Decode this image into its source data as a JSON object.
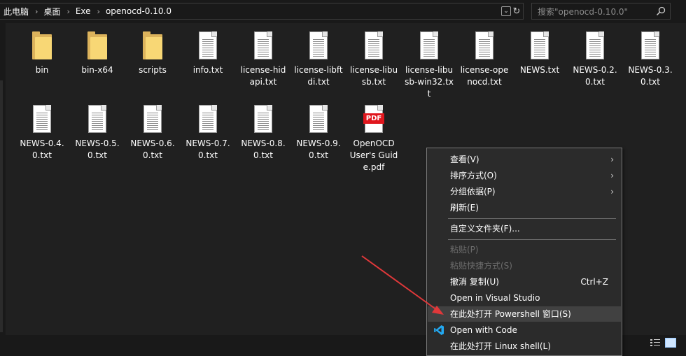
{
  "address": {
    "crumbs": [
      "此电脑",
      "桌面",
      "Exe",
      "openocd-0.10.0"
    ]
  },
  "search": {
    "placeholder": "搜索\"openocd-0.10.0\""
  },
  "files": [
    {
      "label": "bin",
      "kind": "folder"
    },
    {
      "label": "bin-x64",
      "kind": "folder"
    },
    {
      "label": "scripts",
      "kind": "folder"
    },
    {
      "label": "info.txt",
      "kind": "text"
    },
    {
      "label": "license-hidapi.txt",
      "kind": "text"
    },
    {
      "label": "license-libftdi.txt",
      "kind": "text"
    },
    {
      "label": "license-libusb.txt",
      "kind": "text"
    },
    {
      "label": "license-libusb-win32.txt",
      "kind": "text"
    },
    {
      "label": "license-openocd.txt",
      "kind": "text"
    },
    {
      "label": "NEWS.txt",
      "kind": "text"
    },
    {
      "label": "NEWS-0.2.0.txt",
      "kind": "text"
    },
    {
      "label": "NEWS-0.3.0.txt",
      "kind": "text"
    },
    {
      "label": "NEWS-0.4.0.txt",
      "kind": "text"
    },
    {
      "label": "NEWS-0.5.0.txt",
      "kind": "text"
    },
    {
      "label": "NEWS-0.6.0.txt",
      "kind": "text"
    },
    {
      "label": "NEWS-0.7.0.txt",
      "kind": "text"
    },
    {
      "label": "NEWS-0.8.0.txt",
      "kind": "text"
    },
    {
      "label": "NEWS-0.9.0.txt",
      "kind": "text"
    },
    {
      "label": "OpenOCD User's Guide.pdf",
      "kind": "pdf",
      "badge": "PDF"
    }
  ],
  "context_menu": {
    "view": "查看(V)",
    "sort": "排序方式(O)",
    "group": "分组依据(P)",
    "refresh": "刷新(E)",
    "customize": "自定义文件夹(F)...",
    "paste": "粘贴(P)",
    "paste_shortcut": "粘贴快捷方式(S)",
    "undo_copy": "撤消 复制(U)",
    "undo_shortcut": "Ctrl+Z",
    "open_vs": "Open in Visual Studio",
    "open_powershell": "在此处打开 Powershell 窗口(S)",
    "open_code": "Open with Code",
    "open_linux": "在此处打开 Linux shell(L)"
  },
  "colors": {
    "background": "#202020",
    "menu_background": "#2b2b2b",
    "arrow": "#e0383a",
    "pdf_badge": "#e0161d"
  }
}
